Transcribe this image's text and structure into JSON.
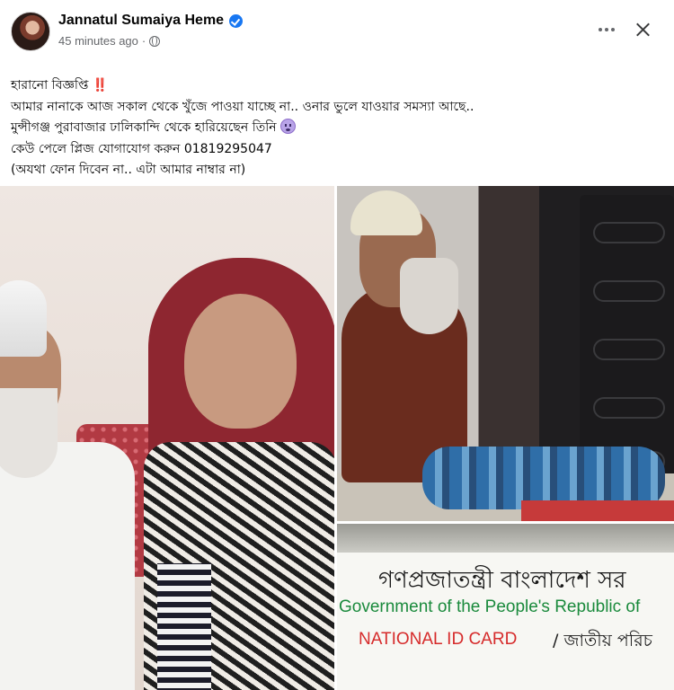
{
  "post": {
    "author": "Jannatul Sumaiya Heme",
    "timestamp": "45 minutes ago",
    "privacy_icon": "globe-icon",
    "verified_icon": "verified-badge-icon",
    "lines": [
      "হারানো বিজ্ঞপ্তি",
      "আমার নানাকে আজ সকাল থেকে খুঁজে পাওয়া যাচ্ছে না.. ওনার ভুলে যাওয়ার সমস্যা আছে..",
      "মুন্সীগঞ্জ পুরাবাজার ঢালিকান্দি থেকে হারিয়েছেন তিনি",
      "কেউ পেলে প্লিজ যোগাযোগ করুন 01819295047",
      "(অযথা ফোন দিবেন না.. এটা আমার নাম্বার না)"
    ],
    "title_emoji": "‼️"
  },
  "photos": {
    "id_card": {
      "bn_title": "গণপ্রজাতন্ত্রী বাংলাদেশ সর",
      "en_title": "Government of the People's Republic of",
      "nid_label": "NATIONAL ID CARD",
      "nid_bn": "/ জাতীয় পরিচ"
    }
  },
  "colors": {
    "accent": "#1877f2",
    "secondary_text": "#65676b",
    "id_green": "#1a8a3c",
    "id_red": "#d62b2b"
  }
}
